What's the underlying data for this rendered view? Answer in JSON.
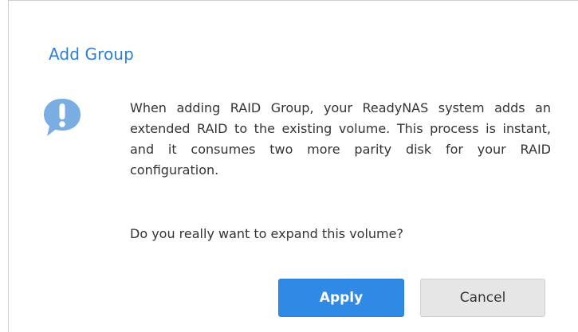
{
  "dialog": {
    "title": "Add Group",
    "icon": "info-speech-bubble-icon",
    "message": "When adding RAID Group, your ReadyNAS system adds an extended RAID to the existing volume. This process is instant, and it consumes two more parity disk for your RAID configuration.",
    "question": "Do you really want to expand this volume?",
    "apply_label": "Apply",
    "cancel_label": "Cancel"
  },
  "colors": {
    "accent": "#2f7fd6",
    "apply_bg": "#2f8ae6",
    "cancel_bg": "#e6e6e6",
    "icon": "#7aaee2"
  }
}
